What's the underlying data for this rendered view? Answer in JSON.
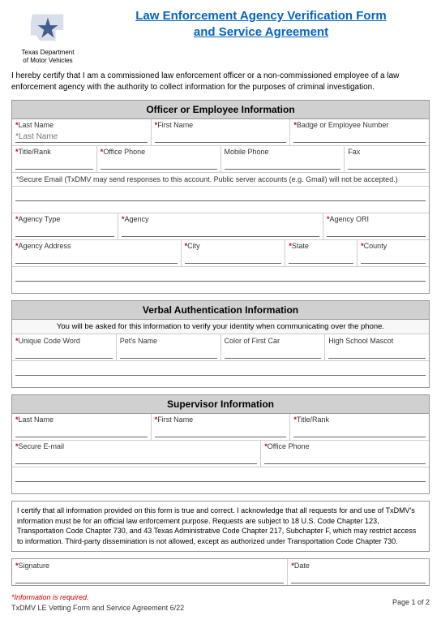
{
  "header": {
    "logo_line1": "Texas Department",
    "logo_line2": "of Motor Vehicles",
    "title_line1": "Law Enforcement Agency Verification Form",
    "title_line2": "and Service Agreement"
  },
  "intro": "I hereby certify that I am a commissioned law enforcement officer or a non-commissioned employee of a law enforcement agency with the authority to collect information for the purposes of criminal investigation.",
  "sections": {
    "officer": {
      "title": "Officer or Employee Information",
      "fields": {
        "last_name_label": "*Last Name",
        "first_name_label": "*First Name",
        "badge_label": "*Badge or Employee Number",
        "title_rank_label": "*Title/Rank",
        "office_phone_label": "*Office Phone",
        "mobile_phone_label": "Mobile Phone",
        "fax_label": "Fax",
        "secure_email_notice": "*Secure Email (TxDMV may send responses to this account. Public server accounts (e.g. Gmail) will not be accepted.)",
        "agency_type_label": "*Agency Type",
        "agency_label": "*Agency",
        "agency_ori_label": "*Agency ORI",
        "agency_address_label": "*Agency Address",
        "city_label": "*City",
        "state_label": "*State",
        "county_label": "*County"
      }
    },
    "verbal": {
      "title": "Verbal Authentication Information",
      "subtitle": "You will be asked for this information to verify your identity when communicating over the phone.",
      "fields": {
        "unique_code_label": "*Unique Code Word",
        "pets_name_label": "Pet's Name",
        "color_first_car_label": "Color of First Car",
        "high_school_mascot_label": "High School Mascot"
      }
    },
    "supervisor": {
      "title": "Supervisor Information",
      "fields": {
        "last_name_label": "*Last Name",
        "first_name_label": "*First Name",
        "title_rank_label": "*Title/Rank",
        "secure_email_label": "*Secure E-mail",
        "office_phone_label": "*Office Phone"
      }
    }
  },
  "footer_text": "I certify that all information provided on this form is true and correct. I acknowledge that all requests for and use of TxDMV's information must be for an official law enforcement purpose. Requests are subject to 18 U.S. Code Chapter 123, Transportation Code Chapter 730, and 43 Texas Administrative Code Chapter 217, Subchapter F, which may restrict access to information. Third-party dissemination is not allowed, except as authorized under Transportation Code Chapter 730.",
  "signature": {
    "label": "*Signature",
    "date_label": "*Date"
  },
  "required_label": "*Information is required.",
  "page_label": "Page 1 of 2",
  "footer_version": "TxDMV LE Vetting Form and Service Agreement 6/22"
}
